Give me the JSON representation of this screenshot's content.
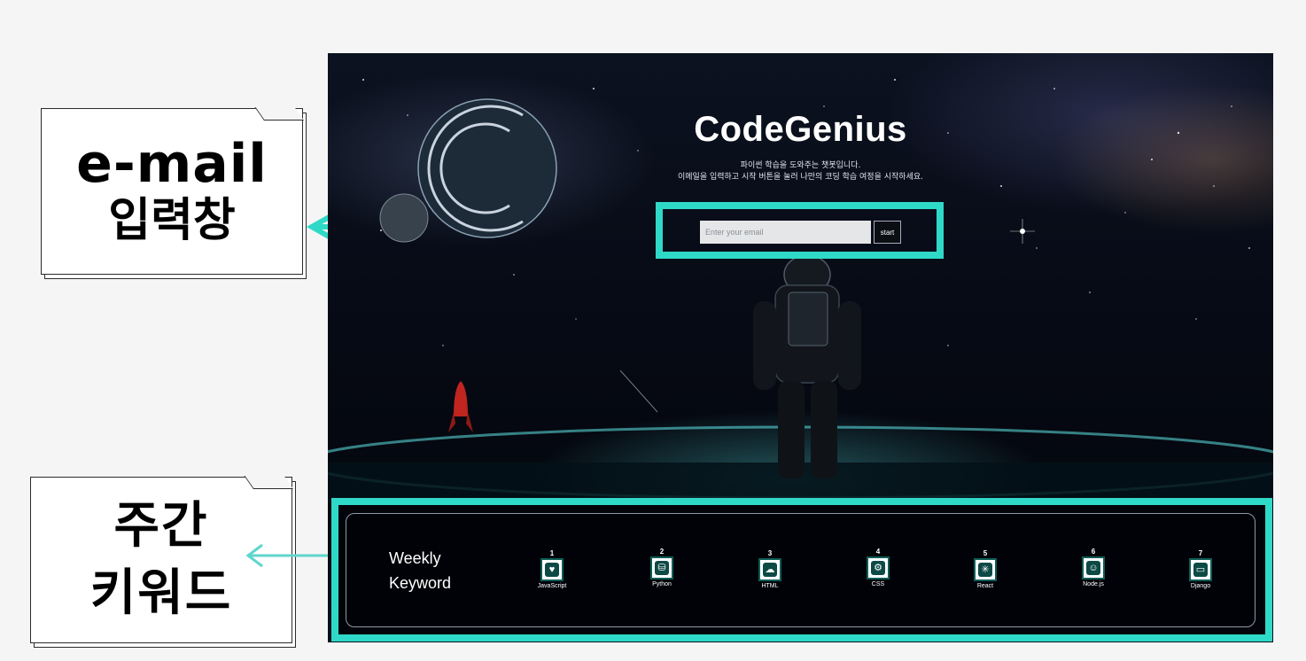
{
  "annotations": {
    "email_callout": {
      "line1": "e-mail",
      "line2": "입력창"
    },
    "keyword_callout": {
      "line1": "주간",
      "line2": "키워드"
    },
    "accent_color": "#2fd9c8"
  },
  "hero": {
    "title": "CodeGenius",
    "subtitle_line1": "파이썬 학습을 도와주는 챗봇입니다.",
    "subtitle_line2": "이메일을 입력하고 시작 버튼을 눌러 나만의 코딩 학습 여정을 시작하세요."
  },
  "email_form": {
    "placeholder": "Enter your email",
    "value": "",
    "start_label": "start"
  },
  "weekly_keywords": {
    "heading_line1": "Weekly",
    "heading_line2": "Keyword",
    "items": [
      {
        "rank": "1",
        "name": "JavaScript",
        "icon": "heart-code-icon"
      },
      {
        "rank": "2",
        "name": "Python",
        "icon": "database-gear-icon"
      },
      {
        "rank": "3",
        "name": "HTML",
        "icon": "cloud-upload-icon"
      },
      {
        "rank": "4",
        "name": "CSS",
        "icon": "browser-gear-icon"
      },
      {
        "rank": "5",
        "name": "React",
        "icon": "network-nodes-icon"
      },
      {
        "rank": "6",
        "name": "Node.js",
        "icon": "head-gear-icon"
      },
      {
        "rank": "7",
        "name": "Django",
        "icon": "monitor-icon"
      }
    ]
  }
}
